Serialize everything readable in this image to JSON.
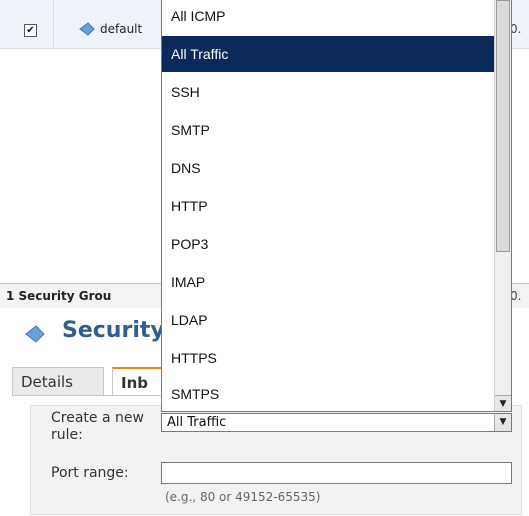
{
  "table_row": {
    "checkbox_mark": "✔",
    "group_name": "default",
    "trailing_text": "0."
  },
  "footer": {
    "text": "1 Security Grou",
    "trailing_text": "0."
  },
  "section": {
    "title": "Security"
  },
  "tabs": [
    {
      "label": "Details"
    },
    {
      "label": "Inb"
    }
  ],
  "rule_form": {
    "create_label": "Create a new rule:",
    "selected_value": "All Traffic",
    "port_label": "Port range:",
    "port_value": "",
    "port_hint": "(e.g., 80 or 49152-65535)"
  },
  "dropdown": {
    "selected": "All Traffic",
    "options": [
      "All ICMP",
      "All Traffic",
      "SSH",
      "SMTP",
      "DNS",
      "HTTP",
      "POP3",
      "IMAP",
      "LDAP",
      "HTTPS",
      "SMTPS"
    ]
  },
  "colors": {
    "selected_option_bg": "#0a2a5c",
    "title_color": "#2f5f8f",
    "active_tab_accent": "#e38b19"
  },
  "icons": {
    "group_icon": "security-group-icon",
    "title_icon": "security-group-icon",
    "select_arrow": "chevron-down-icon"
  }
}
